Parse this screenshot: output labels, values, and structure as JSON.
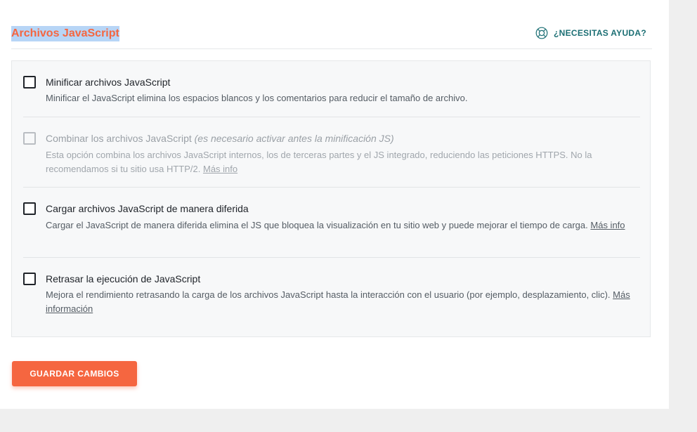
{
  "section": {
    "title": "Archivos JavaScript",
    "help_label": "¿NECESITAS AYUDA?",
    "help_icon": "lifebuoy-icon"
  },
  "colors": {
    "accent": "#f56640",
    "help_teal": "#1c6f74",
    "selection_highlight": "#b7d5f6"
  },
  "options": [
    {
      "title": "Minificar archivos JavaScript",
      "desc": "Minificar el JavaScript elimina los espacios blancos y los comentarios para reducir el tamaño de archivo.",
      "checked": false,
      "disabled": false
    },
    {
      "title": "Combinar los archivos JavaScript",
      "title_note": "(es necesario activar antes la minificación JS)",
      "desc": "Esta opción combina los archivos JavaScript internos, los de terceras partes y el JS integrado, reduciendo las peticiones HTTPS. No la recomendamos si tu sitio usa HTTP/2.",
      "link": "Más info",
      "checked": false,
      "disabled": true
    },
    {
      "title": "Cargar archivos JavaScript de manera diferida",
      "desc": "Cargar el JavaScript de manera diferida elimina el JS que bloquea la visualización en tu sitio web y puede mejorar el tiempo de carga.",
      "link": "Más info",
      "checked": false,
      "disabled": false
    },
    {
      "title": "Retrasar la ejecución de JavaScript",
      "desc": "Mejora el rendimiento retrasando la carga de los archivos JavaScript hasta la interacción con el usuario (por ejemplo, desplazamiento, clic).",
      "link": "Más información",
      "checked": false,
      "disabled": false
    }
  ],
  "save_button": {
    "label": "GUARDAR CAMBIOS"
  }
}
